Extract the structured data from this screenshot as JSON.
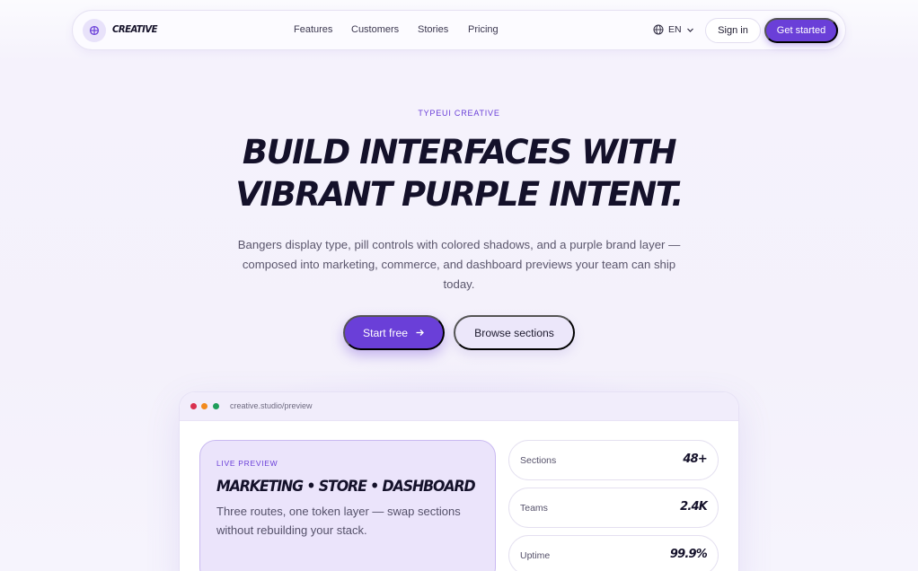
{
  "nav": {
    "brand": "CREATIVE",
    "links": [
      "Features",
      "Customers",
      "Stories",
      "Pricing"
    ],
    "language": "EN",
    "sign_in": "Sign in",
    "get_started": "Get started"
  },
  "hero": {
    "eyebrow": "TYPEUI CREATIVE",
    "title_line1": "Build interfaces with",
    "title_line2": "vibrant purple intent.",
    "subtitle": "Bangers display type, pill controls with colored shadows, and a purple brand layer — composed into marketing, commerce, and dashboard previews your team can ship today.",
    "primary_cta": "Start free",
    "secondary_cta": "Browse sections"
  },
  "preview": {
    "url": "creative.studio/preview",
    "live_eyebrow": "LIVE PREVIEW",
    "live_title": "Marketing • Store • Dashboard",
    "live_desc": "Three routes, one token layer — swap sections without rebuilding your stack.",
    "stats": [
      {
        "label": "Sections",
        "value": "48+"
      },
      {
        "label": "Teams",
        "value": "2.4K"
      },
      {
        "label": "Uptime",
        "value": "99.9%"
      }
    ]
  },
  "colors": {
    "accent": "#6a3fd8",
    "accent_soft": "#ebe4fb",
    "window_dots": [
      "#d9304f",
      "#f28a1e",
      "#1f9d5a"
    ]
  }
}
